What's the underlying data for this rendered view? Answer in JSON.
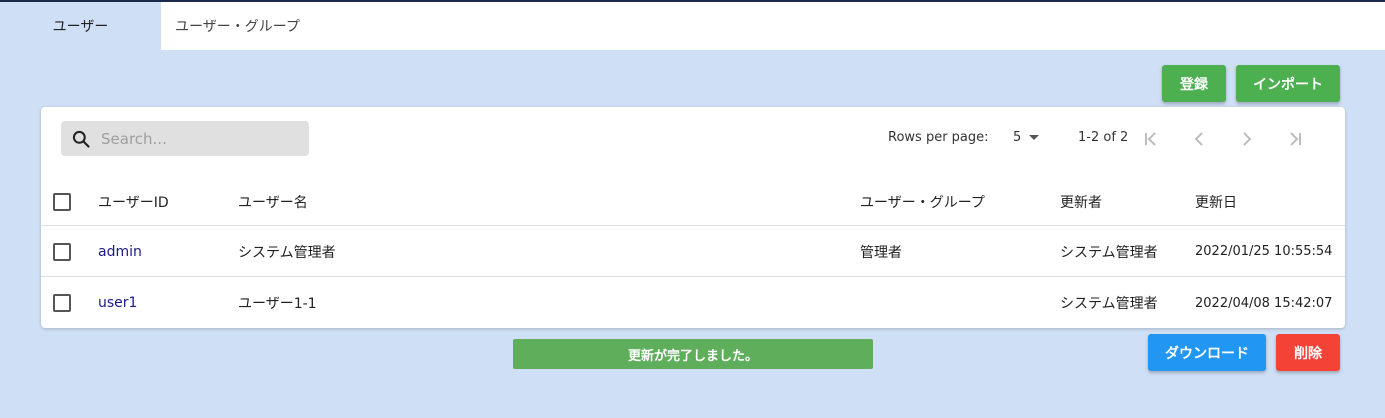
{
  "tabs": {
    "active": "ユーザー",
    "inactive": "ユーザー・グループ"
  },
  "actions": {
    "register": "登録",
    "import": "インポート",
    "download": "ダウンロード",
    "delete": "削除"
  },
  "search": {
    "placeholder": "Search..."
  },
  "pagination": {
    "rows_label": "Rows per page:",
    "rows_value": "5",
    "range": "1-2 of 2"
  },
  "table": {
    "columns": [
      "ユーザーID",
      "ユーザー名",
      "ユーザー・グループ",
      "更新者",
      "更新日"
    ],
    "rows": [
      {
        "id": "admin",
        "name": "システム管理者",
        "group": "管理者",
        "updated_by": "システム管理者",
        "updated_at": "2022/01/25 10:55:54"
      },
      {
        "id": "user1",
        "name": "ユーザー1-1",
        "group": "",
        "updated_by": "システム管理者",
        "updated_at": "2022/04/08 15:42:07"
      }
    ]
  },
  "toast": {
    "message": "更新が完了しました。"
  },
  "icons": {
    "search": "search-icon",
    "first": "first-page-icon",
    "prev": "chevron-left-icon",
    "next": "chevron-right-icon",
    "last": "last-page-icon",
    "caret": "arrow-drop-down-icon"
  },
  "colors": {
    "background": "#cfdff5",
    "green": "#4caf50",
    "blue": "#2196f3",
    "red": "#f44336",
    "toast": "#5fae5c",
    "link": "#1a1a8c"
  }
}
